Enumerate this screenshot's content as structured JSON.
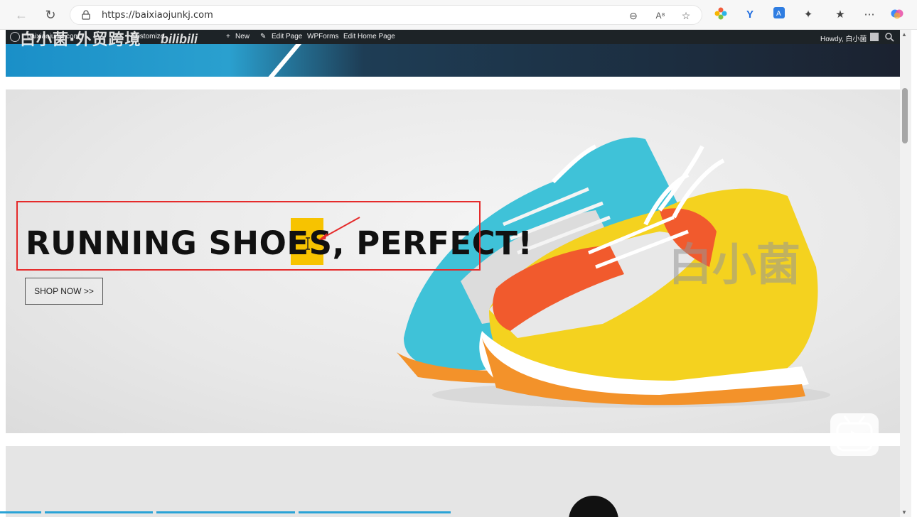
{
  "browser": {
    "url": "https://baixiaojunkj.com",
    "icons": [
      "back-icon",
      "refresh-icon",
      "lock-icon",
      "zoom-out-icon",
      "read-aloud-icon",
      "favorite-star-icon",
      "extension-flower-icon",
      "extension-v-icon",
      "extension-translate-icon",
      "extensions-puzzle-icon",
      "favorites-icon",
      "more-icon",
      "copilot-icon"
    ]
  },
  "wp_admin_bar": {
    "site_name": "baixiaojunkj.com",
    "customize": "Customize",
    "new": "New",
    "edit_page": "Edit Page",
    "wpforms": "WPForms",
    "edit_home_page": "Edit Home Page",
    "howdy": "Howdy, 白小菌"
  },
  "watermarks": {
    "top_channel": "白小菌·外贸跨境",
    "top_logo": "bilibili",
    "center": "白小菌"
  },
  "hero": {
    "title_part1": "RUNNING SHOES",
    "title_comma": ",",
    "title_part2": "PERFECT!",
    "shop_button": "SHOP NOW >>"
  },
  "colors": {
    "annotation": "#e52b2b",
    "highlight": "#f7c300",
    "admin_bar": "#1d2327",
    "banner_accent": "#1a8fc8"
  }
}
